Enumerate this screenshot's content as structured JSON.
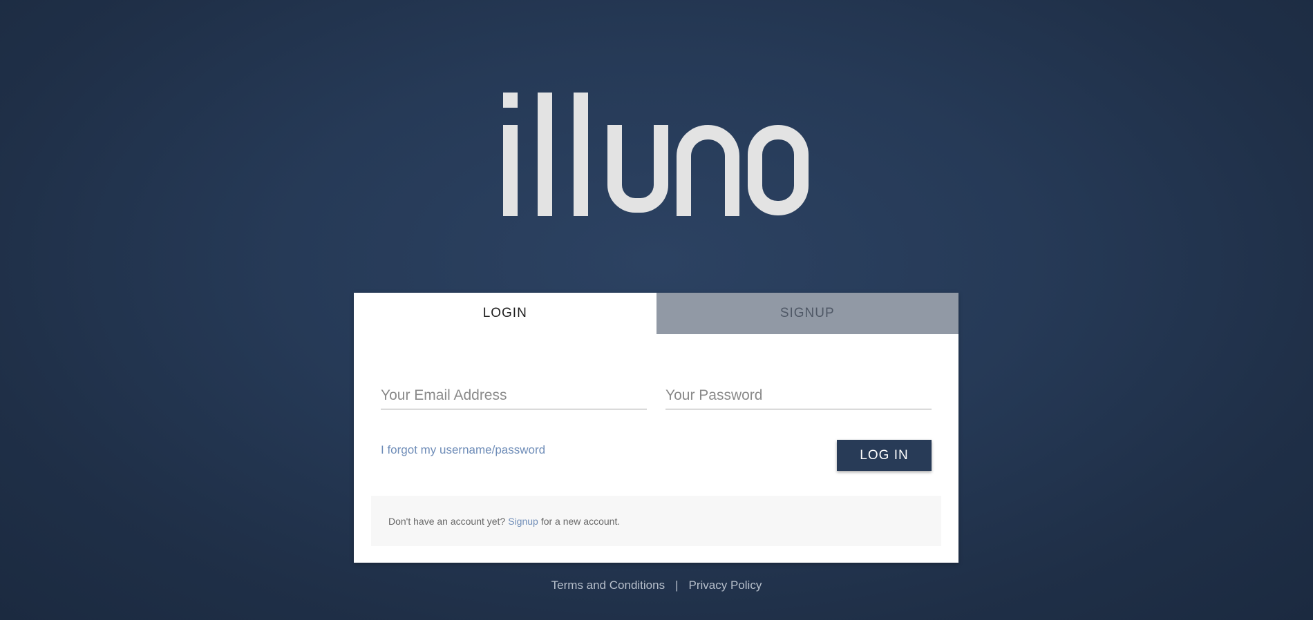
{
  "brand": {
    "logo_icon": "illuno-wordmark-logo"
  },
  "tabs": {
    "login_label": "LOGIN",
    "signup_label": "SIGNUP",
    "active": "login"
  },
  "form": {
    "email_placeholder": "Your Email Address",
    "password_placeholder": "Your Password",
    "email_value": "",
    "password_value": "",
    "forgot_link": "I forgot my username/password",
    "login_button": "LOG IN"
  },
  "signup_prompt": {
    "before": "Don't have an account yet?",
    "link": "Signup",
    "after": "for a new account."
  },
  "footer": {
    "terms": "Terms and Conditions",
    "separator": "|",
    "privacy": "Privacy Policy"
  },
  "colors": {
    "background": "#263a57",
    "button": "#283b57",
    "link": "#6f8db8",
    "inactive_tab": "#9199a5",
    "logo": "#e3e3e3"
  }
}
